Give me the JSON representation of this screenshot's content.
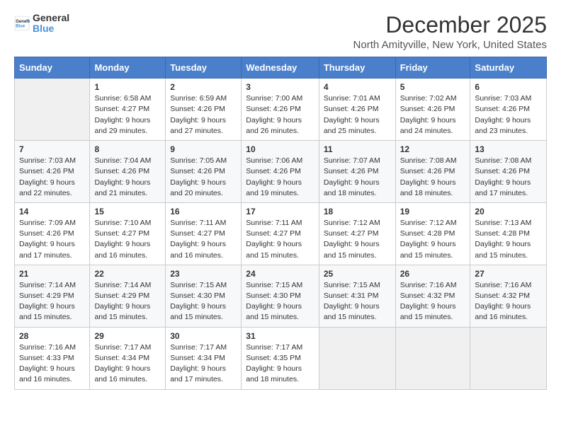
{
  "logo": {
    "general": "General",
    "blue": "Blue"
  },
  "title": "December 2025",
  "subtitle": "North Amityville, New York, United States",
  "header": {
    "accent_color": "#4a7fcb"
  },
  "days_of_week": [
    "Sunday",
    "Monday",
    "Tuesday",
    "Wednesday",
    "Thursday",
    "Friday",
    "Saturday"
  ],
  "weeks": [
    [
      {
        "day": "",
        "sunrise": "",
        "sunset": "",
        "daylight": ""
      },
      {
        "day": "1",
        "sunrise": "Sunrise: 6:58 AM",
        "sunset": "Sunset: 4:27 PM",
        "daylight": "Daylight: 9 hours and 29 minutes."
      },
      {
        "day": "2",
        "sunrise": "Sunrise: 6:59 AM",
        "sunset": "Sunset: 4:26 PM",
        "daylight": "Daylight: 9 hours and 27 minutes."
      },
      {
        "day": "3",
        "sunrise": "Sunrise: 7:00 AM",
        "sunset": "Sunset: 4:26 PM",
        "daylight": "Daylight: 9 hours and 26 minutes."
      },
      {
        "day": "4",
        "sunrise": "Sunrise: 7:01 AM",
        "sunset": "Sunset: 4:26 PM",
        "daylight": "Daylight: 9 hours and 25 minutes."
      },
      {
        "day": "5",
        "sunrise": "Sunrise: 7:02 AM",
        "sunset": "Sunset: 4:26 PM",
        "daylight": "Daylight: 9 hours and 24 minutes."
      },
      {
        "day": "6",
        "sunrise": "Sunrise: 7:03 AM",
        "sunset": "Sunset: 4:26 PM",
        "daylight": "Daylight: 9 hours and 23 minutes."
      }
    ],
    [
      {
        "day": "7",
        "sunrise": "Sunrise: 7:03 AM",
        "sunset": "Sunset: 4:26 PM",
        "daylight": "Daylight: 9 hours and 22 minutes."
      },
      {
        "day": "8",
        "sunrise": "Sunrise: 7:04 AM",
        "sunset": "Sunset: 4:26 PM",
        "daylight": "Daylight: 9 hours and 21 minutes."
      },
      {
        "day": "9",
        "sunrise": "Sunrise: 7:05 AM",
        "sunset": "Sunset: 4:26 PM",
        "daylight": "Daylight: 9 hours and 20 minutes."
      },
      {
        "day": "10",
        "sunrise": "Sunrise: 7:06 AM",
        "sunset": "Sunset: 4:26 PM",
        "daylight": "Daylight: 9 hours and 19 minutes."
      },
      {
        "day": "11",
        "sunrise": "Sunrise: 7:07 AM",
        "sunset": "Sunset: 4:26 PM",
        "daylight": "Daylight: 9 hours and 18 minutes."
      },
      {
        "day": "12",
        "sunrise": "Sunrise: 7:08 AM",
        "sunset": "Sunset: 4:26 PM",
        "daylight": "Daylight: 9 hours and 18 minutes."
      },
      {
        "day": "13",
        "sunrise": "Sunrise: 7:08 AM",
        "sunset": "Sunset: 4:26 PM",
        "daylight": "Daylight: 9 hours and 17 minutes."
      }
    ],
    [
      {
        "day": "14",
        "sunrise": "Sunrise: 7:09 AM",
        "sunset": "Sunset: 4:26 PM",
        "daylight": "Daylight: 9 hours and 17 minutes."
      },
      {
        "day": "15",
        "sunrise": "Sunrise: 7:10 AM",
        "sunset": "Sunset: 4:27 PM",
        "daylight": "Daylight: 9 hours and 16 minutes."
      },
      {
        "day": "16",
        "sunrise": "Sunrise: 7:11 AM",
        "sunset": "Sunset: 4:27 PM",
        "daylight": "Daylight: 9 hours and 16 minutes."
      },
      {
        "day": "17",
        "sunrise": "Sunrise: 7:11 AM",
        "sunset": "Sunset: 4:27 PM",
        "daylight": "Daylight: 9 hours and 15 minutes."
      },
      {
        "day": "18",
        "sunrise": "Sunrise: 7:12 AM",
        "sunset": "Sunset: 4:27 PM",
        "daylight": "Daylight: 9 hours and 15 minutes."
      },
      {
        "day": "19",
        "sunrise": "Sunrise: 7:12 AM",
        "sunset": "Sunset: 4:28 PM",
        "daylight": "Daylight: 9 hours and 15 minutes."
      },
      {
        "day": "20",
        "sunrise": "Sunrise: 7:13 AM",
        "sunset": "Sunset: 4:28 PM",
        "daylight": "Daylight: 9 hours and 15 minutes."
      }
    ],
    [
      {
        "day": "21",
        "sunrise": "Sunrise: 7:14 AM",
        "sunset": "Sunset: 4:29 PM",
        "daylight": "Daylight: 9 hours and 15 minutes."
      },
      {
        "day": "22",
        "sunrise": "Sunrise: 7:14 AM",
        "sunset": "Sunset: 4:29 PM",
        "daylight": "Daylight: 9 hours and 15 minutes."
      },
      {
        "day": "23",
        "sunrise": "Sunrise: 7:15 AM",
        "sunset": "Sunset: 4:30 PM",
        "daylight": "Daylight: 9 hours and 15 minutes."
      },
      {
        "day": "24",
        "sunrise": "Sunrise: 7:15 AM",
        "sunset": "Sunset: 4:30 PM",
        "daylight": "Daylight: 9 hours and 15 minutes."
      },
      {
        "day": "25",
        "sunrise": "Sunrise: 7:15 AM",
        "sunset": "Sunset: 4:31 PM",
        "daylight": "Daylight: 9 hours and 15 minutes."
      },
      {
        "day": "26",
        "sunrise": "Sunrise: 7:16 AM",
        "sunset": "Sunset: 4:32 PM",
        "daylight": "Daylight: 9 hours and 15 minutes."
      },
      {
        "day": "27",
        "sunrise": "Sunrise: 7:16 AM",
        "sunset": "Sunset: 4:32 PM",
        "daylight": "Daylight: 9 hours and 16 minutes."
      }
    ],
    [
      {
        "day": "28",
        "sunrise": "Sunrise: 7:16 AM",
        "sunset": "Sunset: 4:33 PM",
        "daylight": "Daylight: 9 hours and 16 minutes."
      },
      {
        "day": "29",
        "sunrise": "Sunrise: 7:17 AM",
        "sunset": "Sunset: 4:34 PM",
        "daylight": "Daylight: 9 hours and 16 minutes."
      },
      {
        "day": "30",
        "sunrise": "Sunrise: 7:17 AM",
        "sunset": "Sunset: 4:34 PM",
        "daylight": "Daylight: 9 hours and 17 minutes."
      },
      {
        "day": "31",
        "sunrise": "Sunrise: 7:17 AM",
        "sunset": "Sunset: 4:35 PM",
        "daylight": "Daylight: 9 hours and 18 minutes."
      },
      {
        "day": "",
        "sunrise": "",
        "sunset": "",
        "daylight": ""
      },
      {
        "day": "",
        "sunrise": "",
        "sunset": "",
        "daylight": ""
      },
      {
        "day": "",
        "sunrise": "",
        "sunset": "",
        "daylight": ""
      }
    ]
  ]
}
